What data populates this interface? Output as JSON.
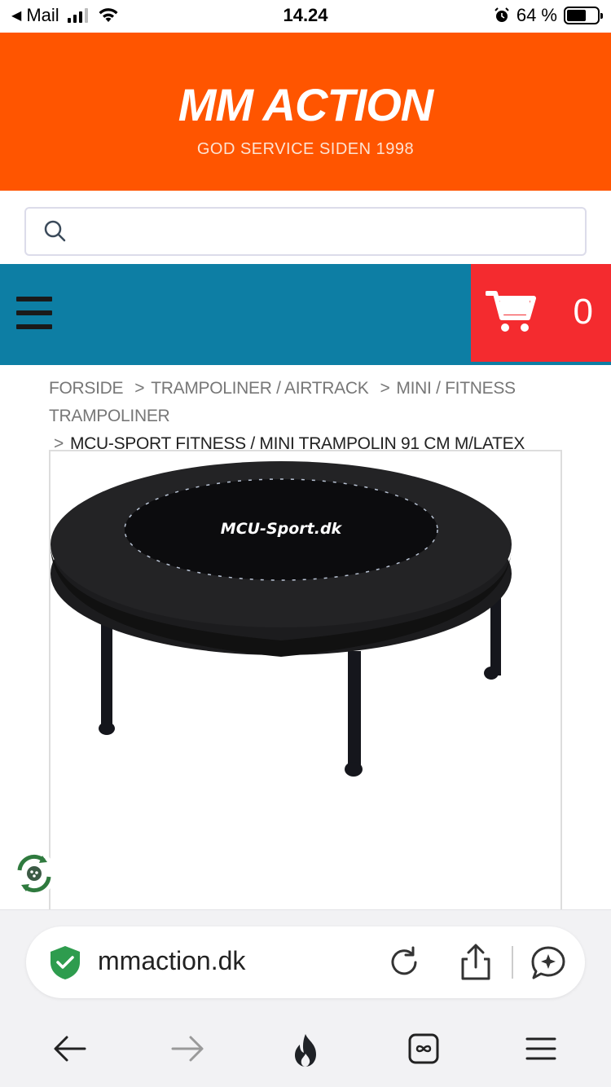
{
  "status_bar": {
    "back_app": "Mail",
    "time": "14.24",
    "battery": "64 %",
    "battery_level": 0.64
  },
  "header": {
    "logo": "MM ACTION",
    "tagline": "GOD SERVICE SIDEN 1998",
    "brand_color": "#ff5500"
  },
  "search": {
    "placeholder": ""
  },
  "nav": {
    "cart_count": "0",
    "nav_color": "#0d7ea4",
    "cart_color": "#f42b2f"
  },
  "breadcrumb": {
    "items": [
      "FORSIDE",
      "TRAMPOLINER / AIRTRACK",
      "MINI / FITNESS TRAMPOLINER"
    ],
    "current": "MCU-SPORT FITNESS / MINI TRAMPOLIN 91 CM M/LATEX",
    "separator": ">"
  },
  "product": {
    "image_brand_text": "MCU-Sport.dk"
  },
  "browser": {
    "url": "mmaction.dk"
  }
}
